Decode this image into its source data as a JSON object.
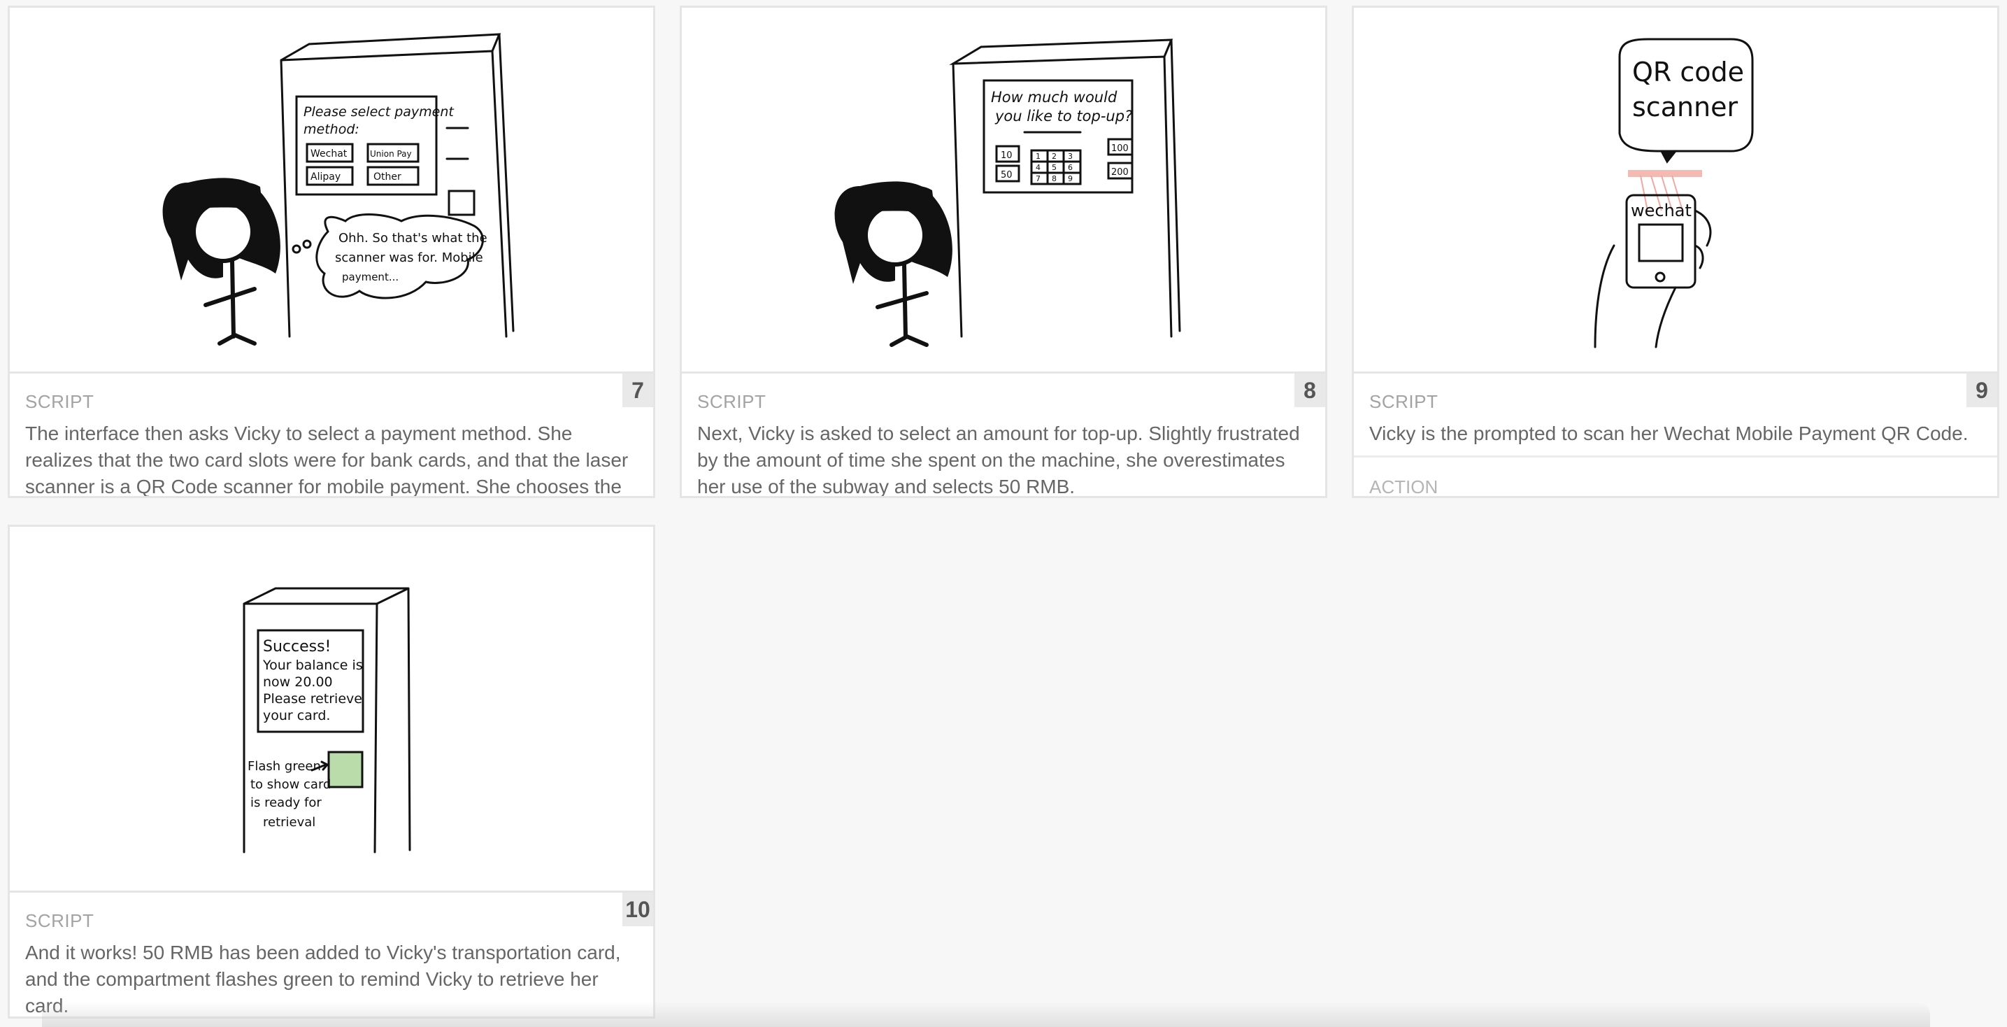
{
  "panels": [
    {
      "number": "7",
      "label": "SCRIPT",
      "text": "The interface then asks Vicky to select a payment method. She realizes that the two card slots were for bank cards, and that the laser scanner is a QR Code scanner for mobile payment. She chooses the",
      "sketch": {
        "screen_lines": [
          "Please select payment",
          "method:"
        ],
        "options": [
          "Wechat",
          "Union Pay",
          "Alipay",
          "Other"
        ],
        "bubble_lines": [
          "Ohh. So that's what the",
          "scanner was for. Mobile",
          "payment..."
        ]
      }
    },
    {
      "number": "8",
      "label": "SCRIPT",
      "text": "Next, Vicky is asked to select an amount for top-up. Slightly frustrated by the amount of time she spent on the machine, she overestimates her use of the subway and selects 50 RMB.",
      "sketch": {
        "screen_lines": [
          "How much would",
          "you like to top-up?"
        ],
        "amounts": [
          "10",
          "50",
          "100",
          "200"
        ],
        "keypad": [
          "1",
          "2",
          "3",
          "4",
          "5",
          "6",
          "7",
          "8",
          "9"
        ]
      }
    },
    {
      "number": "9",
      "label": "SCRIPT",
      "text": "Vicky is the prompted to scan her Wechat Mobile Payment QR Code.",
      "label2": "ACTION",
      "sketch": {
        "bubble_lines": [
          "QR code",
          "scanner"
        ],
        "phone_label": "wechat"
      }
    },
    {
      "number": "10",
      "label": "SCRIPT",
      "text": "And it works! 50 RMB has been added to Vicky's transportation card, and the compartment flashes green to remind Vicky to retrieve her card.",
      "sketch": {
        "screen_lines": [
          "Success!",
          "Your balance is",
          "now 20.00",
          "Please retrieve",
          "your card."
        ],
        "note_lines": [
          "Flash green",
          "to show card",
          "is ready for",
          "retrieval"
        ]
      }
    }
  ],
  "colors": {
    "background": "#f7f7f7",
    "card_border": "#e5e5e5",
    "label": "#a3a3a3",
    "text": "#666666",
    "flash_green": "#b9dcaa",
    "laser_red": "#f2a7a0"
  }
}
